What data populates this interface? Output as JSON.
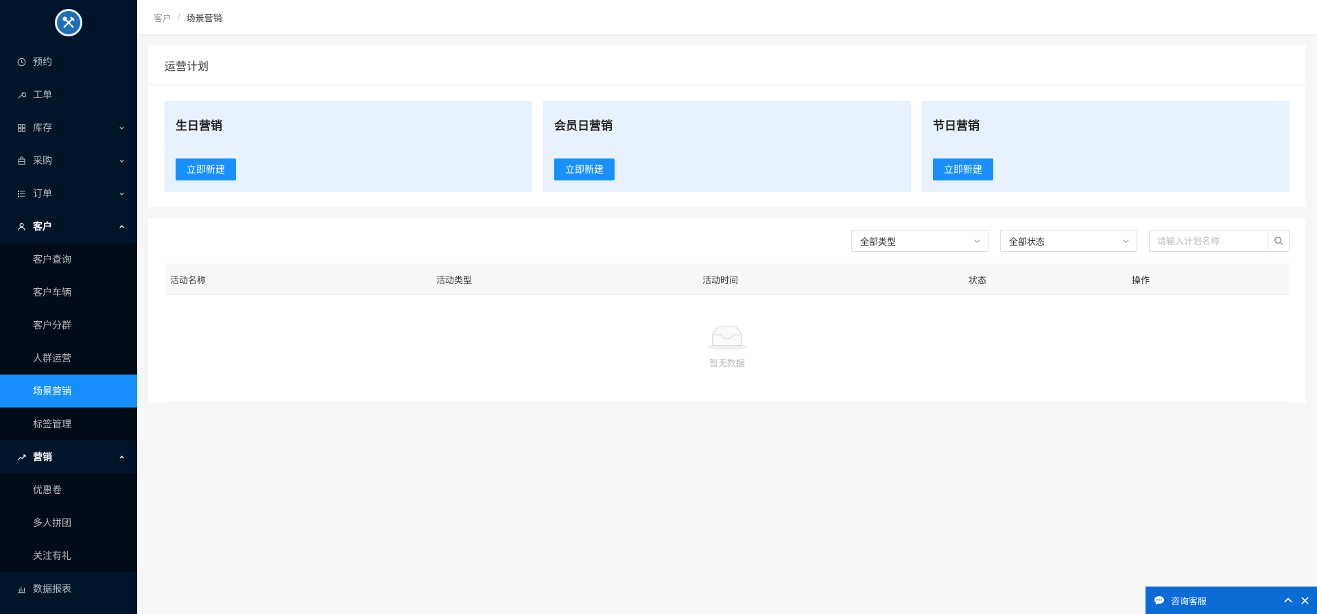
{
  "breadcrumb": {
    "parent": "客户",
    "separator": "/",
    "current": "场景营销"
  },
  "sidebar": {
    "items": [
      {
        "label": "预约",
        "icon": "clock-icon"
      },
      {
        "label": "工单",
        "icon": "wrench-icon"
      },
      {
        "label": "库存",
        "icon": "grid-icon"
      },
      {
        "label": "采购",
        "icon": "bag-icon"
      },
      {
        "label": "订单",
        "icon": "list-icon"
      },
      {
        "label": "客户",
        "icon": "user-icon"
      },
      {
        "label": "营销",
        "icon": "trend-icon"
      },
      {
        "label": "数据报表",
        "icon": "bar-chart-icon"
      }
    ],
    "customer_sub": [
      "客户查询",
      "客户车辆",
      "客户分群",
      "人群运营",
      "场景营销",
      "标签管理"
    ],
    "marketing_sub": [
      "优惠卷",
      "多人拼团",
      "关注有礼"
    ],
    "active": "场景营销"
  },
  "plan": {
    "title": "运营计划",
    "cards": [
      {
        "title": "生日营销",
        "button": "立即新建"
      },
      {
        "title": "会员日营销",
        "button": "立即新建"
      },
      {
        "title": "节日营销",
        "button": "立即新建"
      }
    ]
  },
  "filters": {
    "type_select": "全部类型",
    "status_select": "全部状态",
    "search_placeholder": "请输入计划名称"
  },
  "table": {
    "columns": [
      "活动名称",
      "活动类型",
      "活动时间",
      "状态",
      "操作"
    ],
    "empty_text": "暂无数据"
  },
  "chat": {
    "label": "咨询客服"
  },
  "colors": {
    "sidebar_bg": "#001529",
    "accent": "#1890ff",
    "card_bg": "#e8f2fe",
    "chat_bg": "#0a6bd4"
  }
}
